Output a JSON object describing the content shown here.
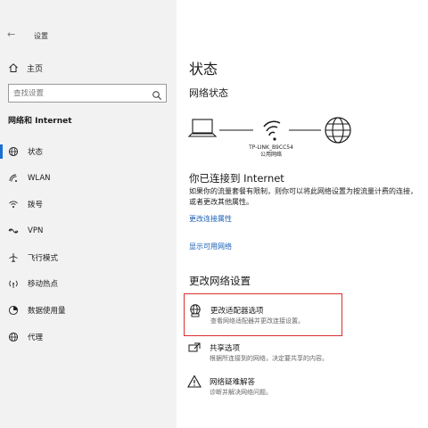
{
  "window": {
    "title": "设置",
    "back_glyph": "←"
  },
  "sidebar": {
    "home_label": "主页",
    "search_placeholder": "查找设置",
    "section_title": "网络和 Internet",
    "items": [
      {
        "label": "状态",
        "icon": "globe-status-icon",
        "active": true
      },
      {
        "label": "WLAN",
        "icon": "wifi-icon"
      },
      {
        "label": "拨号",
        "icon": "dialup-icon"
      },
      {
        "label": "VPN",
        "icon": "vpn-icon"
      },
      {
        "label": "飞行模式",
        "icon": "airplane-icon"
      },
      {
        "label": "移动热点",
        "icon": "hotspot-icon"
      },
      {
        "label": "数据使用量",
        "icon": "data-usage-icon"
      },
      {
        "label": "代理",
        "icon": "globe-icon"
      }
    ]
  },
  "main": {
    "title": "状态",
    "network_status_heading": "网络状态",
    "network": {
      "ssid": "TP-LINK_B9CC54",
      "type": "公用网络"
    },
    "connected_heading": "你已连接到 Internet",
    "connected_desc": "如果你的流量套餐有限制，则你可以将此网络设置为按流量计费的连接，或者更改其他属性。",
    "link_properties": "更改连接属性",
    "link_available": "显示可用网络",
    "change_heading": "更改网络设置",
    "options": [
      {
        "title": "更改适配器选项",
        "subtitle": "查看网络适配器并更改连接设置。",
        "icon": "adapter-icon",
        "highlighted": true
      },
      {
        "title": "共享选项",
        "subtitle": "根据所连接到的网络，决定要共享的内容。",
        "icon": "sharing-icon"
      },
      {
        "title": "网络疑难解答",
        "subtitle": "诊断并解决网络问题。",
        "icon": "warning-icon"
      }
    ],
    "highlight_color": "#d9302f"
  },
  "colors": {
    "accent": "#1a6fd1",
    "link": "#1a5fb4",
    "sidebar_bg": "#f2f2f2"
  }
}
